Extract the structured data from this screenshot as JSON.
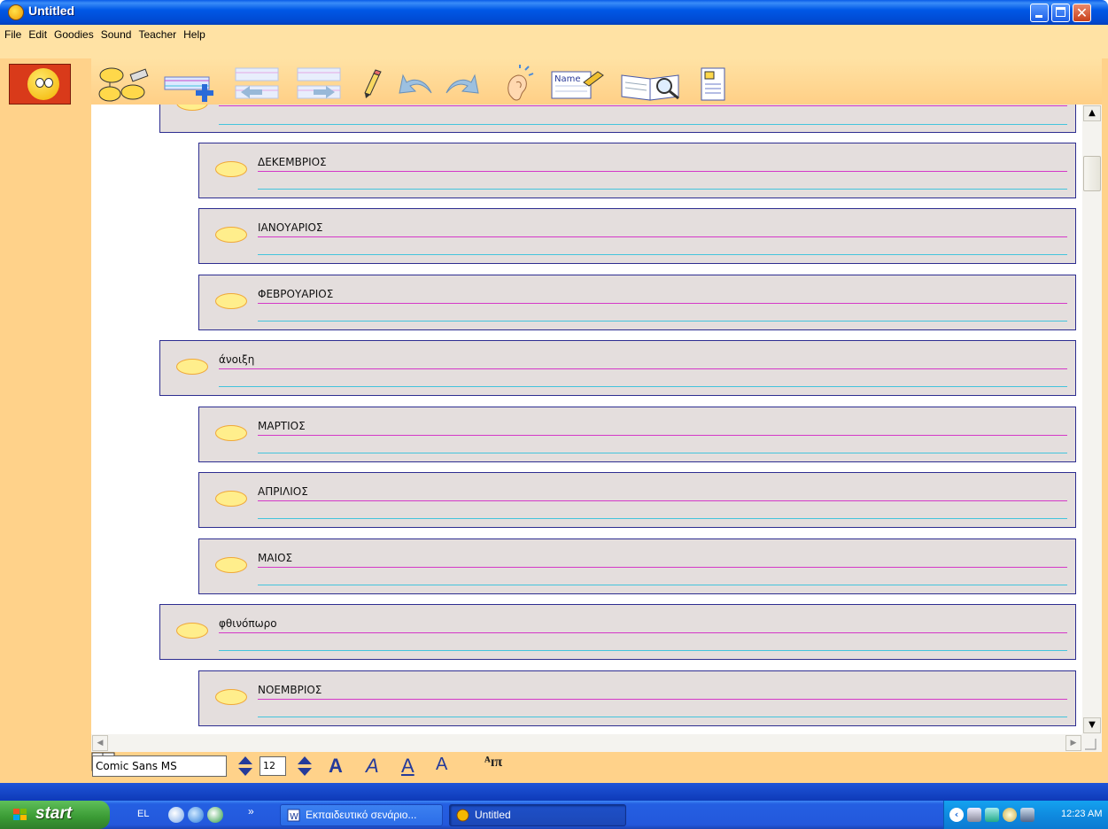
{
  "window": {
    "title": "Untitled"
  },
  "menu": [
    "File",
    "Edit",
    "Goodies",
    "Sound",
    "Teacher",
    "Help"
  ],
  "toolbar_icons": [
    "flow-diagram-icon",
    "add-line-icon",
    "move-left-icon",
    "move-right-icon",
    "pencil-icon",
    "undo-icon",
    "redo-icon",
    "ear-icon",
    "name-tag-icon",
    "book-search-icon",
    "note-page-icon"
  ],
  "outline": {
    "items": [
      {
        "level": 1,
        "label": ""
      },
      {
        "level": 2,
        "label": "ΔΕΚΕΜΒΡΙΟΣ"
      },
      {
        "level": 2,
        "label": "ΙΑΝΟΥΑΡΙΟΣ"
      },
      {
        "level": 2,
        "label": "ΦΕΒΡΟΥΑΡΙΟΣ"
      },
      {
        "level": 1,
        "label": "άνοιξη"
      },
      {
        "level": 2,
        "label": "ΜΑΡΤΙΟΣ"
      },
      {
        "level": 2,
        "label": "ΑΠΡΙΛΙΟΣ"
      },
      {
        "level": 2,
        "label": "ΜΑΙΟΣ"
      },
      {
        "level": 1,
        "label": "φθινόπωρο"
      },
      {
        "level": 2,
        "label": "ΝΟΕΜΒΡΙΟΣ"
      }
    ]
  },
  "fontbar": {
    "font_name": "Comic Sans MS",
    "font_size": "12",
    "bold_label": "A",
    "italic_label": "A",
    "underline_label": "A",
    "color_label": "A",
    "lang_label": "ᴬɪπ"
  },
  "taskbar": {
    "start_label": "start",
    "language": "EL",
    "more": "»",
    "tasks": [
      {
        "label": "Εκπαιδευτικό σενάριο...",
        "active": false
      },
      {
        "label": "Untitled",
        "active": true
      }
    ],
    "clock": "12:23 AM"
  },
  "colors": {
    "title_bar": "#0058e6",
    "frame": "#ffd28a",
    "box_fill": "#e4dedd",
    "box_border": "#2d2d90",
    "oval_fill": "#ffee8c",
    "line_magenta": "#d438c8",
    "line_cyan": "#44c4dc"
  }
}
